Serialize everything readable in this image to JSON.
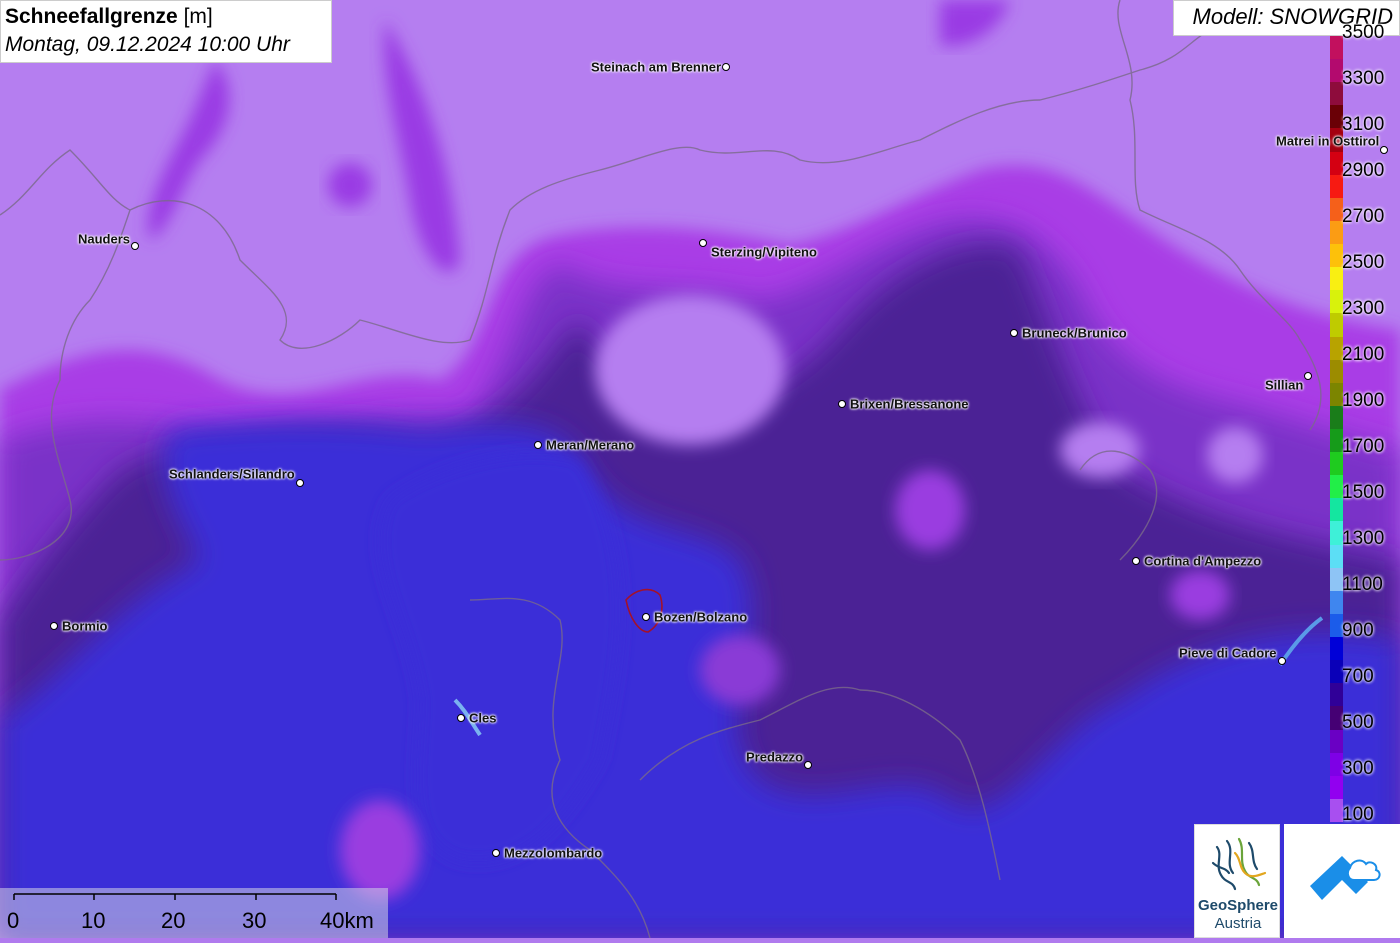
{
  "title": {
    "variable": "Schneefallgrenze",
    "unit": "[m]",
    "datetime": "Montag, 09.12.2024 10:00 Uhr"
  },
  "model": "Modell: SNOWGRID",
  "legend": {
    "labels": [
      "3500",
      "3300",
      "3100",
      "2900",
      "2700",
      "2500",
      "2300",
      "2100",
      "1900",
      "1700",
      "1500",
      "1300",
      "1100",
      "900",
      "700",
      "500",
      "300",
      "100"
    ],
    "colors": [
      "#c2105e",
      "#b30a6e",
      "#8e0c3c",
      "#6a0006",
      "#a50010",
      "#d40012",
      "#f71a12",
      "#f5601a",
      "#fb9c14",
      "#fdc10a",
      "#f9ef12",
      "#d8f20c",
      "#bfcb00",
      "#b8a300",
      "#9c8c00",
      "#7c8500",
      "#1a7d1a",
      "#169b1a",
      "#1fcb1f",
      "#22ee48",
      "#14e6a0",
      "#3ef0d8",
      "#5cdef5",
      "#8ec4f5",
      "#3f86ef",
      "#1b5cea",
      "#0000d8",
      "#0a00b8",
      "#300098",
      "#450074",
      "#6a00c4",
      "#7e00e6",
      "#9200f0",
      "#a84ff0"
    ]
  },
  "cities": [
    {
      "name": "Steinach am Brenner",
      "side": "left"
    },
    {
      "name": "Nauders",
      "side": "left"
    },
    {
      "name": "Sterzing/Vipiteno",
      "side": "right"
    },
    {
      "name": "Matrei in Osttirol",
      "side": "left"
    },
    {
      "name": "Bruneck/Brunico",
      "side": "right"
    },
    {
      "name": "Sillian",
      "side": "left"
    },
    {
      "name": "Brixen/Bressanone",
      "side": "right"
    },
    {
      "name": "Meran/Merano",
      "side": "right"
    },
    {
      "name": "Schlanders/Silandro",
      "side": "left"
    },
    {
      "name": "Cortina d'Ampezzo",
      "side": "right"
    },
    {
      "name": "Bozen/Bolzano",
      "side": "right"
    },
    {
      "name": "Pieve di Cadore",
      "side": "left"
    },
    {
      "name": "Bormio",
      "side": "right"
    },
    {
      "name": "Cles",
      "side": "right"
    },
    {
      "name": "Predazzo",
      "side": "left"
    },
    {
      "name": "Mezzolombardo",
      "side": "right"
    }
  ],
  "scale": {
    "labels": [
      "0",
      "10",
      "20",
      "30",
      "40km"
    ]
  },
  "logos": {
    "geosphere_line1": "GeoSphere",
    "geosphere_line2": "Austria"
  }
}
